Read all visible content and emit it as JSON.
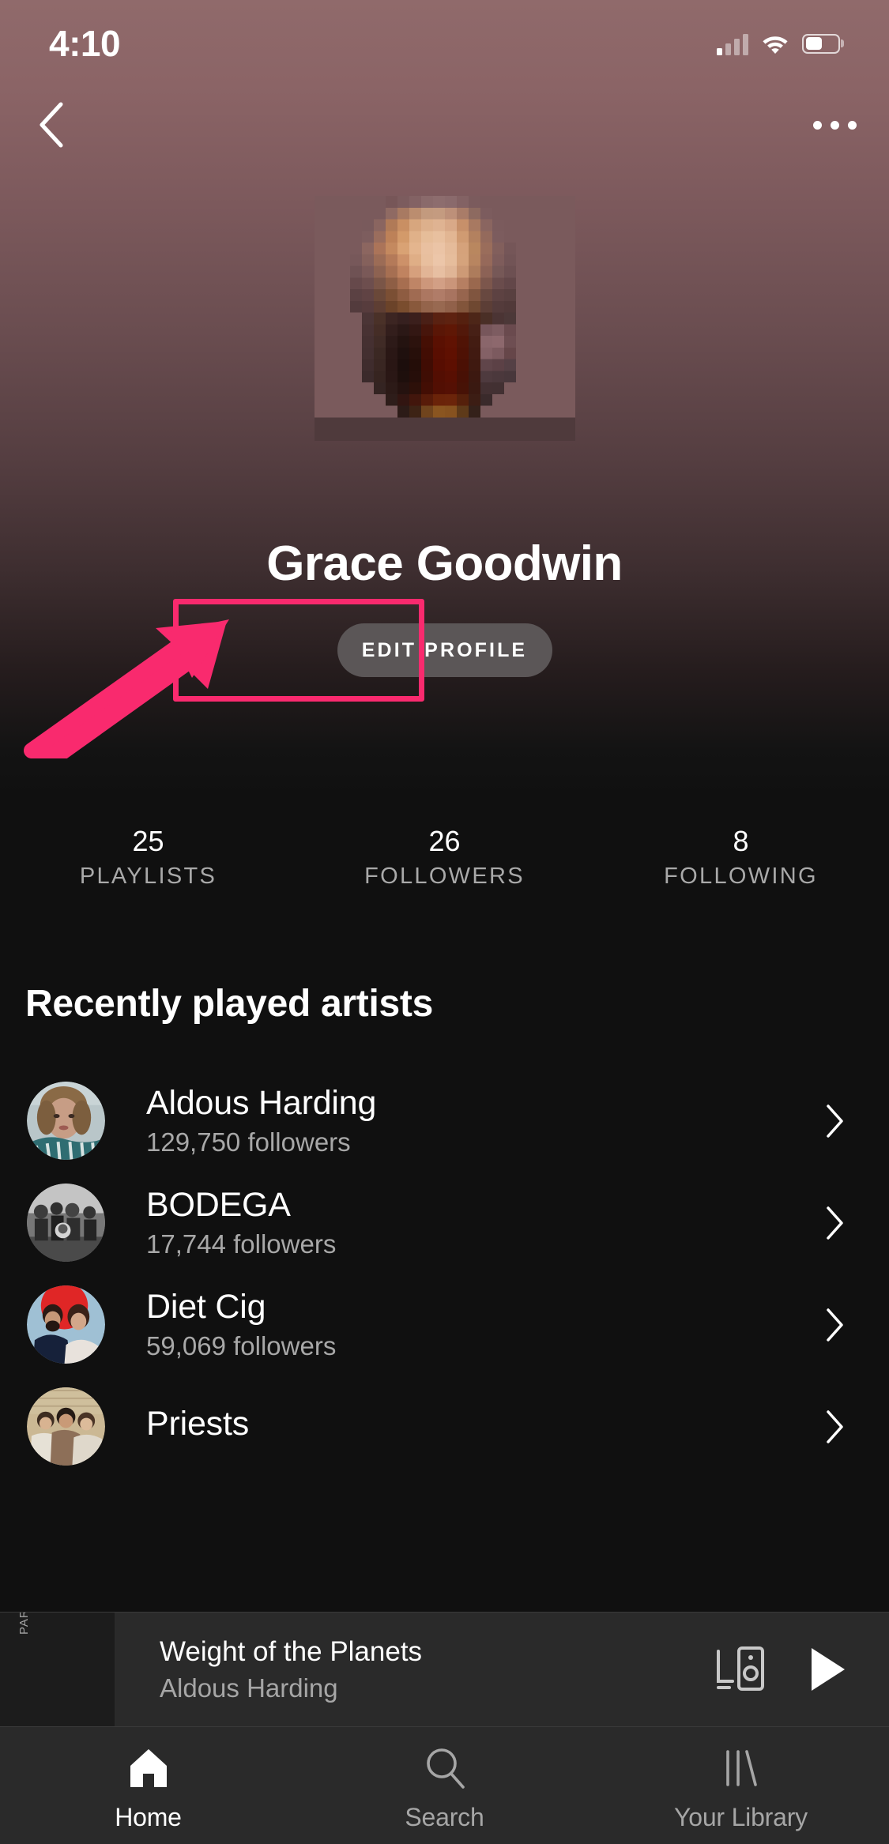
{
  "status_bar": {
    "time": "4:10",
    "cellular_icon": "cellular-signal-icon",
    "wifi_icon": "wifi-icon",
    "battery_icon": "battery-icon"
  },
  "nav": {
    "back_icon": "chevron-left-icon",
    "more_icon": "more-options-icon"
  },
  "profile": {
    "avatar_name": "profile-avatar-pixelated",
    "display_name": "Grace Goodwin",
    "edit_button_label": "EDIT PROFILE"
  },
  "annotation": {
    "color": "#f92a6e",
    "target": "edit-profile-button",
    "shapes": [
      "highlight-rectangle",
      "pointer-arrow"
    ]
  },
  "stats": [
    {
      "value": "25",
      "label": "PLAYLISTS"
    },
    {
      "value": "26",
      "label": "FOLLOWERS"
    },
    {
      "value": "8",
      "label": "FOLLOWING"
    }
  ],
  "recently_played": {
    "title": "Recently played artists",
    "artists": [
      {
        "name": "Aldous Harding",
        "followers": "129,750 followers",
        "chevron": "chevron-right-icon"
      },
      {
        "name": "BODEGA",
        "followers": "17,744 followers",
        "chevron": "chevron-right-icon"
      },
      {
        "name": "Diet Cig",
        "followers": "59,069 followers",
        "chevron": "chevron-right-icon"
      },
      {
        "name": "Priests",
        "followers": "",
        "chevron": "chevron-right-icon"
      }
    ]
  },
  "now_playing": {
    "album_art_text": "PARTY",
    "track_title": "Weight of the Planets",
    "artist": "Aldous Harding",
    "connect_icon": "connect-to-device-icon",
    "play_icon": "play-icon"
  },
  "tab_bar": {
    "tabs": [
      {
        "label": "Home",
        "icon": "home-icon",
        "active": true
      },
      {
        "label": "Search",
        "icon": "search-icon",
        "active": false
      },
      {
        "label": "Your Library",
        "icon": "library-icon",
        "active": false
      }
    ]
  },
  "colors": {
    "accent_pink": "#f92a6e",
    "background": "#101010",
    "header_gradient_top": "#906a6b",
    "bar_background": "#2a2a2a"
  }
}
